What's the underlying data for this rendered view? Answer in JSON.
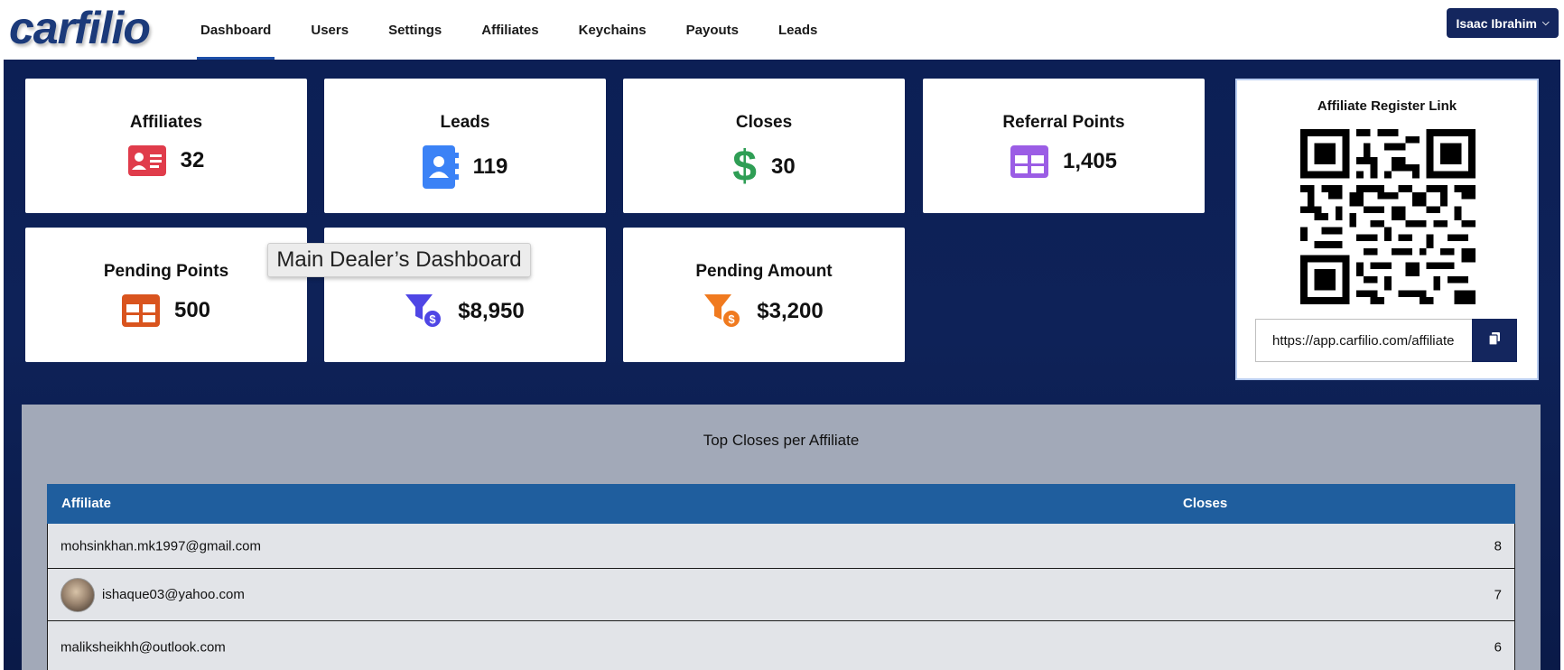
{
  "app": {
    "logo_text": "carfilio"
  },
  "nav": {
    "items": [
      {
        "label": "Dashboard",
        "active": true
      },
      {
        "label": "Users"
      },
      {
        "label": "Settings"
      },
      {
        "label": "Affiliates"
      },
      {
        "label": "Keychains"
      },
      {
        "label": "Payouts"
      },
      {
        "label": "Leads"
      }
    ],
    "user_label": "Isaac Ibrahim"
  },
  "stats": {
    "affiliates": {
      "title": "Affiliates",
      "value": "32",
      "icon": "id-card-icon",
      "color": "#e03c4b"
    },
    "leads": {
      "title": "Leads",
      "value": "119",
      "icon": "address-book-icon",
      "color": "#3b82f6"
    },
    "closes": {
      "title": "Closes",
      "value": "30",
      "icon": "dollar-sign-icon",
      "color": "#2f9e55"
    },
    "referral_points": {
      "title": "Referral Points",
      "value": "1,405",
      "icon": "table-icon",
      "color": "#9b5de5"
    },
    "pending_points": {
      "title": "Pending Points",
      "value": "500",
      "icon": "table-icon",
      "color": "#d9541e"
    },
    "hidden_card": {
      "value": "$8,950",
      "icon": "funnel-dollar-icon",
      "color": "#4f46e5"
    },
    "pending_amount": {
      "title": "Pending Amount",
      "value": "$3,200",
      "icon": "funnel-dollar-icon",
      "color": "#f07a1f"
    }
  },
  "tooltip": {
    "text": "Main Dealer’s Dashboard"
  },
  "register": {
    "title": "Affiliate Register Link",
    "url": "https://app.carfilio.com/affiliate"
  },
  "top_closes": {
    "title": "Top Closes per Affiliate",
    "columns": [
      "Affiliate",
      "Closes"
    ],
    "rows": [
      {
        "email": "mohsinkhan.mk1997@gmail.com",
        "closes": "8",
        "avatar": false
      },
      {
        "email": "ishaque03@yahoo.com",
        "closes": "7",
        "avatar": true
      },
      {
        "email": "maliksheikhh@outlook.com",
        "closes": "6",
        "avatar": false
      }
    ]
  }
}
